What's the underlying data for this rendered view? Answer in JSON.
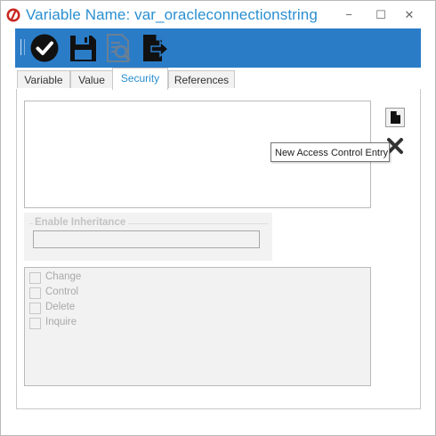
{
  "window": {
    "title": "Variable Name: var_oracleconnectionstring",
    "minimize_glyph": "−",
    "maximize_glyph": "☐",
    "close_glyph": "✕",
    "title_color": "#2a8fd0"
  },
  "toolbar": {
    "background": "#2b7cc7",
    "buttons": [
      {
        "name": "check-circle-icon"
      },
      {
        "name": "save-icon"
      },
      {
        "name": "find-document-icon"
      },
      {
        "name": "export-document-icon"
      }
    ]
  },
  "tabs": [
    {
      "label": "Variable",
      "active": false
    },
    {
      "label": "Value",
      "active": false
    },
    {
      "label": "Security",
      "active": true
    },
    {
      "label": "References",
      "active": false
    }
  ],
  "security": {
    "tooltip": "New Access Control Entry",
    "inheritance_label": "Enable Inheritance",
    "permissions": [
      {
        "label": "Change",
        "checked": false
      },
      {
        "label": "Control",
        "checked": false
      },
      {
        "label": "Delete",
        "checked": false
      },
      {
        "label": "Inquire",
        "checked": false
      }
    ]
  }
}
